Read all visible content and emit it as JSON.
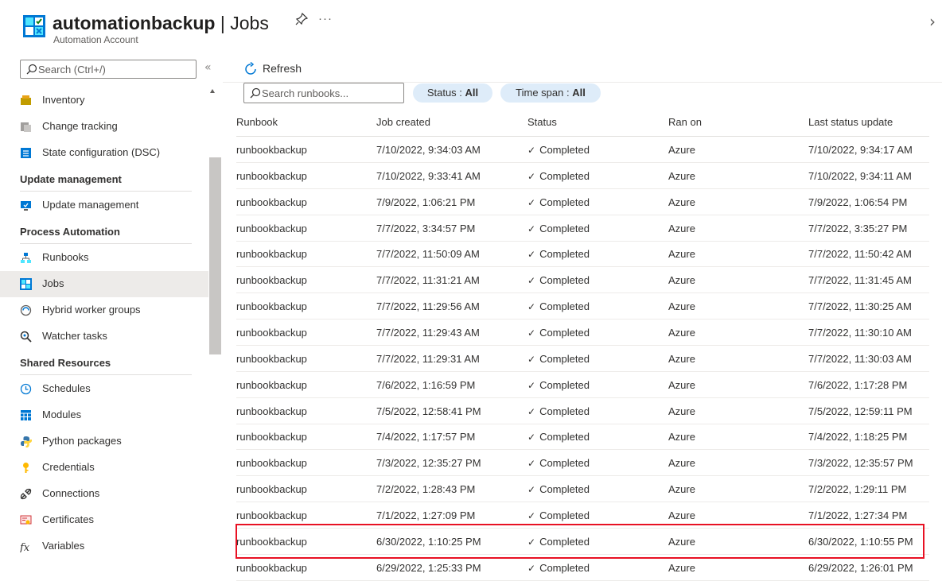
{
  "header": {
    "resource_name": "automationbackup",
    "separator": " | ",
    "page_name": "Jobs",
    "subtitle": "Automation Account",
    "more": "···",
    "close": "›"
  },
  "sidebar": {
    "search_placeholder": "Search (Ctrl+/)",
    "collapse": "«",
    "entries": [
      {
        "kind": "item",
        "label": "Inventory",
        "icon": "inventory-icon"
      },
      {
        "kind": "item",
        "label": "Change tracking",
        "icon": "change-tracking-icon"
      },
      {
        "kind": "item",
        "label": "State configuration (DSC)",
        "icon": "dsc-icon"
      },
      {
        "kind": "heading",
        "label": "Update management"
      },
      {
        "kind": "item",
        "label": "Update management",
        "icon": "update-icon"
      },
      {
        "kind": "heading",
        "label": "Process Automation"
      },
      {
        "kind": "item",
        "label": "Runbooks",
        "icon": "runbooks-icon"
      },
      {
        "kind": "item",
        "label": "Jobs",
        "icon": "jobs-icon",
        "selected": true
      },
      {
        "kind": "item",
        "label": "Hybrid worker groups",
        "icon": "hybrid-worker-icon"
      },
      {
        "kind": "item",
        "label": "Watcher tasks",
        "icon": "watcher-icon"
      },
      {
        "kind": "heading",
        "label": "Shared Resources"
      },
      {
        "kind": "item",
        "label": "Schedules",
        "icon": "clock-icon"
      },
      {
        "kind": "item",
        "label": "Modules",
        "icon": "modules-icon"
      },
      {
        "kind": "item",
        "label": "Python packages",
        "icon": "python-icon"
      },
      {
        "kind": "item",
        "label": "Credentials",
        "icon": "key-icon"
      },
      {
        "kind": "item",
        "label": "Connections",
        "icon": "connections-icon"
      },
      {
        "kind": "item",
        "label": "Certificates",
        "icon": "certificate-icon"
      },
      {
        "kind": "item",
        "label": "Variables",
        "icon": "fx-icon"
      }
    ]
  },
  "toolbar": {
    "refresh_label": "Refresh",
    "search_placeholder": "Search runbooks...",
    "status_filter": {
      "label": "Status : ",
      "value": "All"
    },
    "timespan_filter": {
      "label": "Time span : ",
      "value": "All"
    }
  },
  "table": {
    "columns": [
      "Runbook",
      "Job created",
      "Status",
      "Ran on",
      "Last status update"
    ],
    "rows": [
      [
        "runbookbackup",
        "7/10/2022, 9:34:03 AM",
        "Completed",
        "Azure",
        "7/10/2022, 9:34:17 AM"
      ],
      [
        "runbookbackup",
        "7/10/2022, 9:33:41 AM",
        "Completed",
        "Azure",
        "7/10/2022, 9:34:11 AM"
      ],
      [
        "runbookbackup",
        "7/9/2022, 1:06:21 PM",
        "Completed",
        "Azure",
        "7/9/2022, 1:06:54 PM"
      ],
      [
        "runbookbackup",
        "7/7/2022, 3:34:57 PM",
        "Completed",
        "Azure",
        "7/7/2022, 3:35:27 PM"
      ],
      [
        "runbookbackup",
        "7/7/2022, 11:50:09 AM",
        "Completed",
        "Azure",
        "7/7/2022, 11:50:42 AM"
      ],
      [
        "runbookbackup",
        "7/7/2022, 11:31:21 AM",
        "Completed",
        "Azure",
        "7/7/2022, 11:31:45 AM"
      ],
      [
        "runbookbackup",
        "7/7/2022, 11:29:56 AM",
        "Completed",
        "Azure",
        "7/7/2022, 11:30:25 AM"
      ],
      [
        "runbookbackup",
        "7/7/2022, 11:29:43 AM",
        "Completed",
        "Azure",
        "7/7/2022, 11:30:10 AM"
      ],
      [
        "runbookbackup",
        "7/7/2022, 11:29:31 AM",
        "Completed",
        "Azure",
        "7/7/2022, 11:30:03 AM"
      ],
      [
        "runbookbackup",
        "7/6/2022, 1:16:59 PM",
        "Completed",
        "Azure",
        "7/6/2022, 1:17:28 PM"
      ],
      [
        "runbookbackup",
        "7/5/2022, 12:58:41 PM",
        "Completed",
        "Azure",
        "7/5/2022, 12:59:11 PM"
      ],
      [
        "runbookbackup",
        "7/4/2022, 1:17:57 PM",
        "Completed",
        "Azure",
        "7/4/2022, 1:18:25 PM"
      ],
      [
        "runbookbackup",
        "7/3/2022, 12:35:27 PM",
        "Completed",
        "Azure",
        "7/3/2022, 12:35:57 PM"
      ],
      [
        "runbookbackup",
        "7/2/2022, 1:28:43 PM",
        "Completed",
        "Azure",
        "7/2/2022, 1:29:11 PM"
      ],
      [
        "runbookbackup",
        "7/1/2022, 1:27:09 PM",
        "Completed",
        "Azure",
        "7/1/2022, 1:27:34 PM"
      ],
      [
        "runbookbackup",
        "6/30/2022, 1:10:25 PM",
        "Completed",
        "Azure",
        "6/30/2022, 1:10:55 PM"
      ],
      [
        "runbookbackup",
        "6/29/2022, 1:25:33 PM",
        "Completed",
        "Azure",
        "6/29/2022, 1:26:01 PM"
      ]
    ],
    "highlighted_row": 15,
    "status_check": "✓"
  },
  "colors": {
    "accent": "#0078d4",
    "filter_pill": "#deecf9",
    "selected_nav": "#edebe9",
    "highlight_border": "#e81123"
  }
}
